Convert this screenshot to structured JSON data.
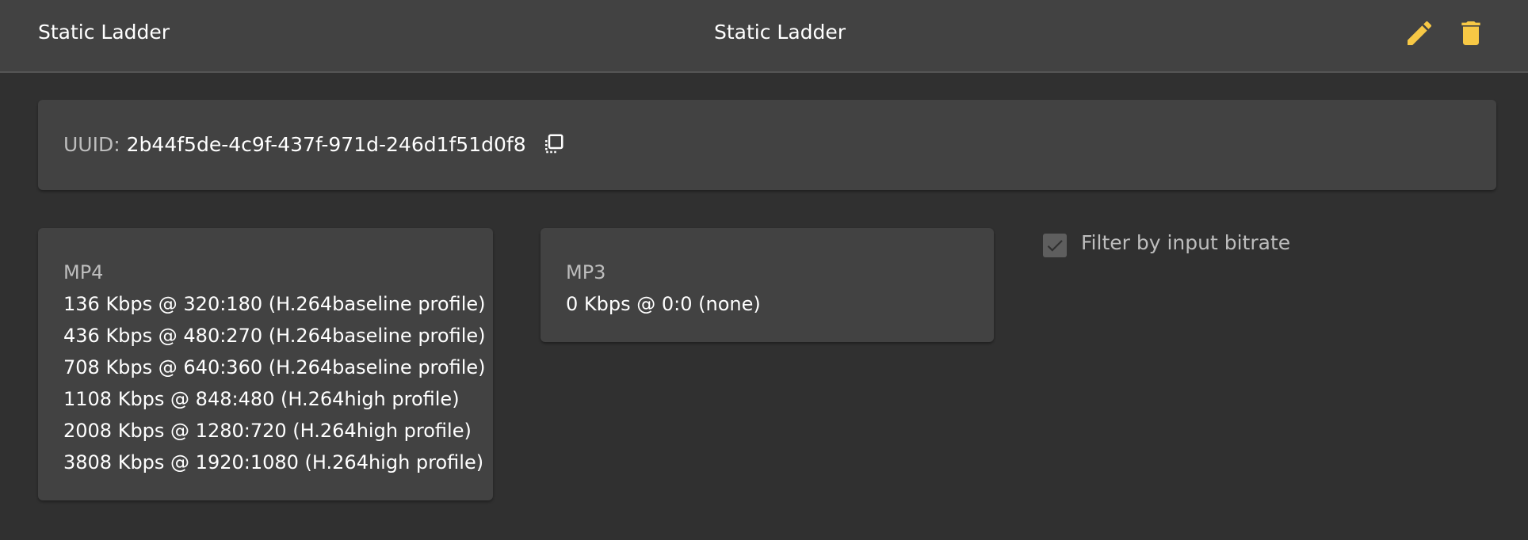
{
  "header": {
    "left_title": "Static Ladder",
    "center_title": "Static Ladder",
    "actions": {
      "edit_icon": "pencil-icon",
      "delete_icon": "trash-icon",
      "accent_color": "#f7c845"
    }
  },
  "uuid": {
    "label": "UUID:",
    "value": "2b44f5de-4c9f-437f-971d-246d1f51d0f8",
    "copy_icon": "copy-icon"
  },
  "mp4": {
    "title": "MP4",
    "items": [
      "136 Kbps @ 320:180 (H.264baseline profile)",
      "436 Kbps @ 480:270 (H.264baseline profile)",
      "708 Kbps @ 640:360 (H.264baseline profile)",
      "1108 Kbps @ 848:480 (H.264high profile)",
      "2008 Kbps @ 1280:720 (H.264high profile)",
      "3808 Kbps @ 1920:1080 (H.264high profile)"
    ]
  },
  "mp3": {
    "title": "MP3",
    "items": [
      "0 Kbps @ 0:0 (none)"
    ]
  },
  "filter": {
    "label": "Filter by input bitrate",
    "checked": true
  }
}
